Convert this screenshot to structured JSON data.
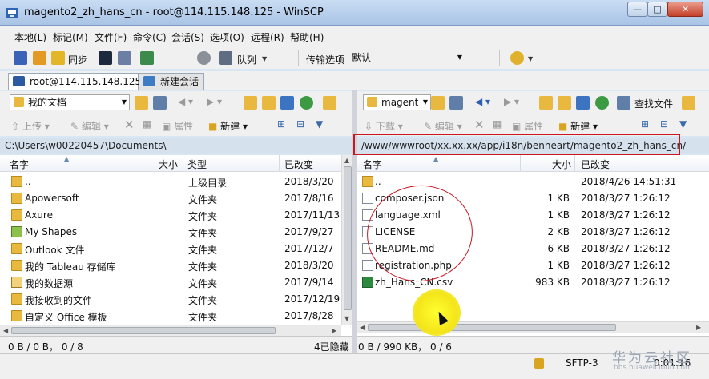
{
  "window": {
    "title": "magento2_zh_hans_cn - root@114.115.148.125 - WinSCP"
  },
  "menu": [
    "本地(L)",
    "标记(M)",
    "文件(F)",
    "命令(C)",
    "会话(S)",
    "选项(O)",
    "远程(R)",
    "帮助(H)"
  ],
  "main_toolbar": {
    "sync_label": "同步",
    "queue_label": "队列",
    "transfer_label": "传输选项",
    "transfer_value": "默认"
  },
  "tabs": {
    "session": "root@114.115.148.125",
    "new_session": "新建会话"
  },
  "local": {
    "location": "我的文档",
    "actions": {
      "upload": "上传",
      "edit": "编辑",
      "properties": "属性",
      "new": "新建"
    },
    "path": "C:\\Users\\w00220457\\Documents\\",
    "columns": {
      "name": "名字",
      "size": "大小",
      "type": "类型",
      "changed": "已改变"
    },
    "rows": [
      {
        "name": "..",
        "size": "",
        "type": "上级目录",
        "changed": "2018/3/20",
        "icon": "up"
      },
      {
        "name": "Apowersoft",
        "size": "",
        "type": "文件夹",
        "changed": "2017/8/16",
        "icon": "folder"
      },
      {
        "name": "Axure",
        "size": "",
        "type": "文件夹",
        "changed": "2017/11/13",
        "icon": "folder"
      },
      {
        "name": "My Shapes",
        "size": "",
        "type": "文件夹",
        "changed": "2017/9/27",
        "icon": "shapes"
      },
      {
        "name": "Outlook 文件",
        "size": "",
        "type": "文件夹",
        "changed": "2017/12/7",
        "icon": "folder"
      },
      {
        "name": "我的 Tableau 存储库",
        "size": "",
        "type": "文件夹",
        "changed": "2018/3/20",
        "icon": "folder"
      },
      {
        "name": "我的数据源",
        "size": "",
        "type": "文件夹",
        "changed": "2017/9/14",
        "icon": "db"
      },
      {
        "name": "我接收到的文件",
        "size": "",
        "type": "文件夹",
        "changed": "2017/12/19",
        "icon": "folder"
      },
      {
        "name": "自定义 Office 模板",
        "size": "",
        "type": "文件夹",
        "changed": "2017/8/28",
        "icon": "folder"
      }
    ],
    "status_left": "0 B / 0 B， 0 / 8",
    "status_right": "4已隐藏"
  },
  "remote": {
    "location": "magent",
    "find_label": "查找文件",
    "actions": {
      "download": "下载",
      "edit": "编辑",
      "properties": "属性",
      "new": "新建"
    },
    "path": "/www/wwwroot/xx.xx.xx/app/i18n/benheart/magento2_zh_hans_cn/",
    "columns": {
      "name": "名字",
      "size": "大小",
      "changed": "已改变"
    },
    "rows": [
      {
        "name": "..",
        "size": "",
        "changed": "2018/4/26 14:51:31",
        "icon": "up"
      },
      {
        "name": "composer.json",
        "size": "1 KB",
        "changed": "2018/3/27 1:26:12",
        "icon": "file"
      },
      {
        "name": "language.xml",
        "size": "1 KB",
        "changed": "2018/3/27 1:26:12",
        "icon": "file"
      },
      {
        "name": "LICENSE",
        "size": "2 KB",
        "changed": "2018/3/27 1:26:12",
        "icon": "file"
      },
      {
        "name": "README.md",
        "size": "6 KB",
        "changed": "2018/3/27 1:26:12",
        "icon": "file"
      },
      {
        "name": "registration.php",
        "size": "1 KB",
        "changed": "2018/3/27 1:26:12",
        "icon": "file"
      },
      {
        "name": "zh_Hans_CN.csv",
        "size": "983 KB",
        "changed": "2018/3/27 1:26:12",
        "icon": "xls"
      }
    ],
    "status_left": "0 B / 990 KB， 0 / 6"
  },
  "bottom": {
    "protocol": "SFTP-3",
    "elapsed": "0:01:16"
  },
  "watermark": {
    "main": "华为云社区",
    "sub": "bbs.huaweicloud.com"
  },
  "colors": {
    "annotation": "#c8171f",
    "cursor_highlight": "#f4e51a",
    "title_bar": "#b9d0ec"
  }
}
